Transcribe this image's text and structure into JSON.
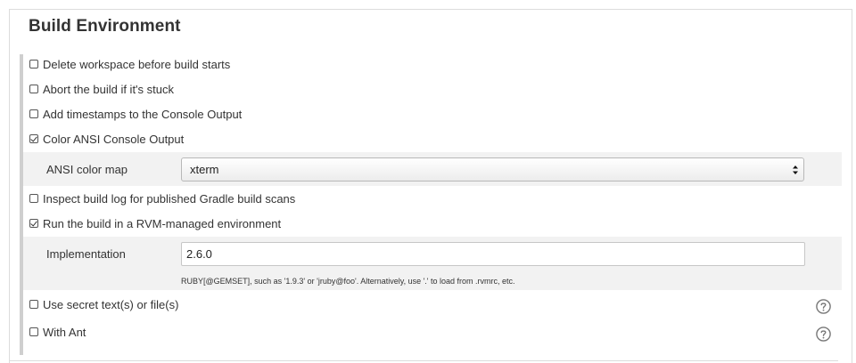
{
  "section": {
    "title": "Build Environment"
  },
  "options": [
    {
      "label": "Delete workspace before build starts",
      "checked": false
    },
    {
      "label": "Abort the build if it's stuck",
      "checked": false
    },
    {
      "label": "Add timestamps to the Console Output",
      "checked": false
    },
    {
      "label": "Color ANSI Console Output",
      "checked": true
    },
    {
      "label": "Inspect build log for published Gradle build scans",
      "checked": false
    },
    {
      "label": "Run the build in a RVM-managed environment",
      "checked": true
    },
    {
      "label": "Use secret text(s) or file(s)",
      "checked": false
    },
    {
      "label": "With Ant",
      "checked": false
    }
  ],
  "ansi": {
    "label": "ANSI color map",
    "selected": "xterm"
  },
  "rvm": {
    "label": "Implementation",
    "value": "2.6.0",
    "hint": "RUBY[@GEMSET], such as '1.9.3' or 'jruby@foo'. Alternatively, use '.' to load from .rvmrc, etc."
  },
  "icons": {
    "help": "help-icon",
    "select_arrows": "select-arrows-icon",
    "check": "checkmark-icon"
  },
  "colors": {
    "shaded_row": "#f2f2f2",
    "gutter": "#cfcfcf",
    "text": "#333333"
  }
}
